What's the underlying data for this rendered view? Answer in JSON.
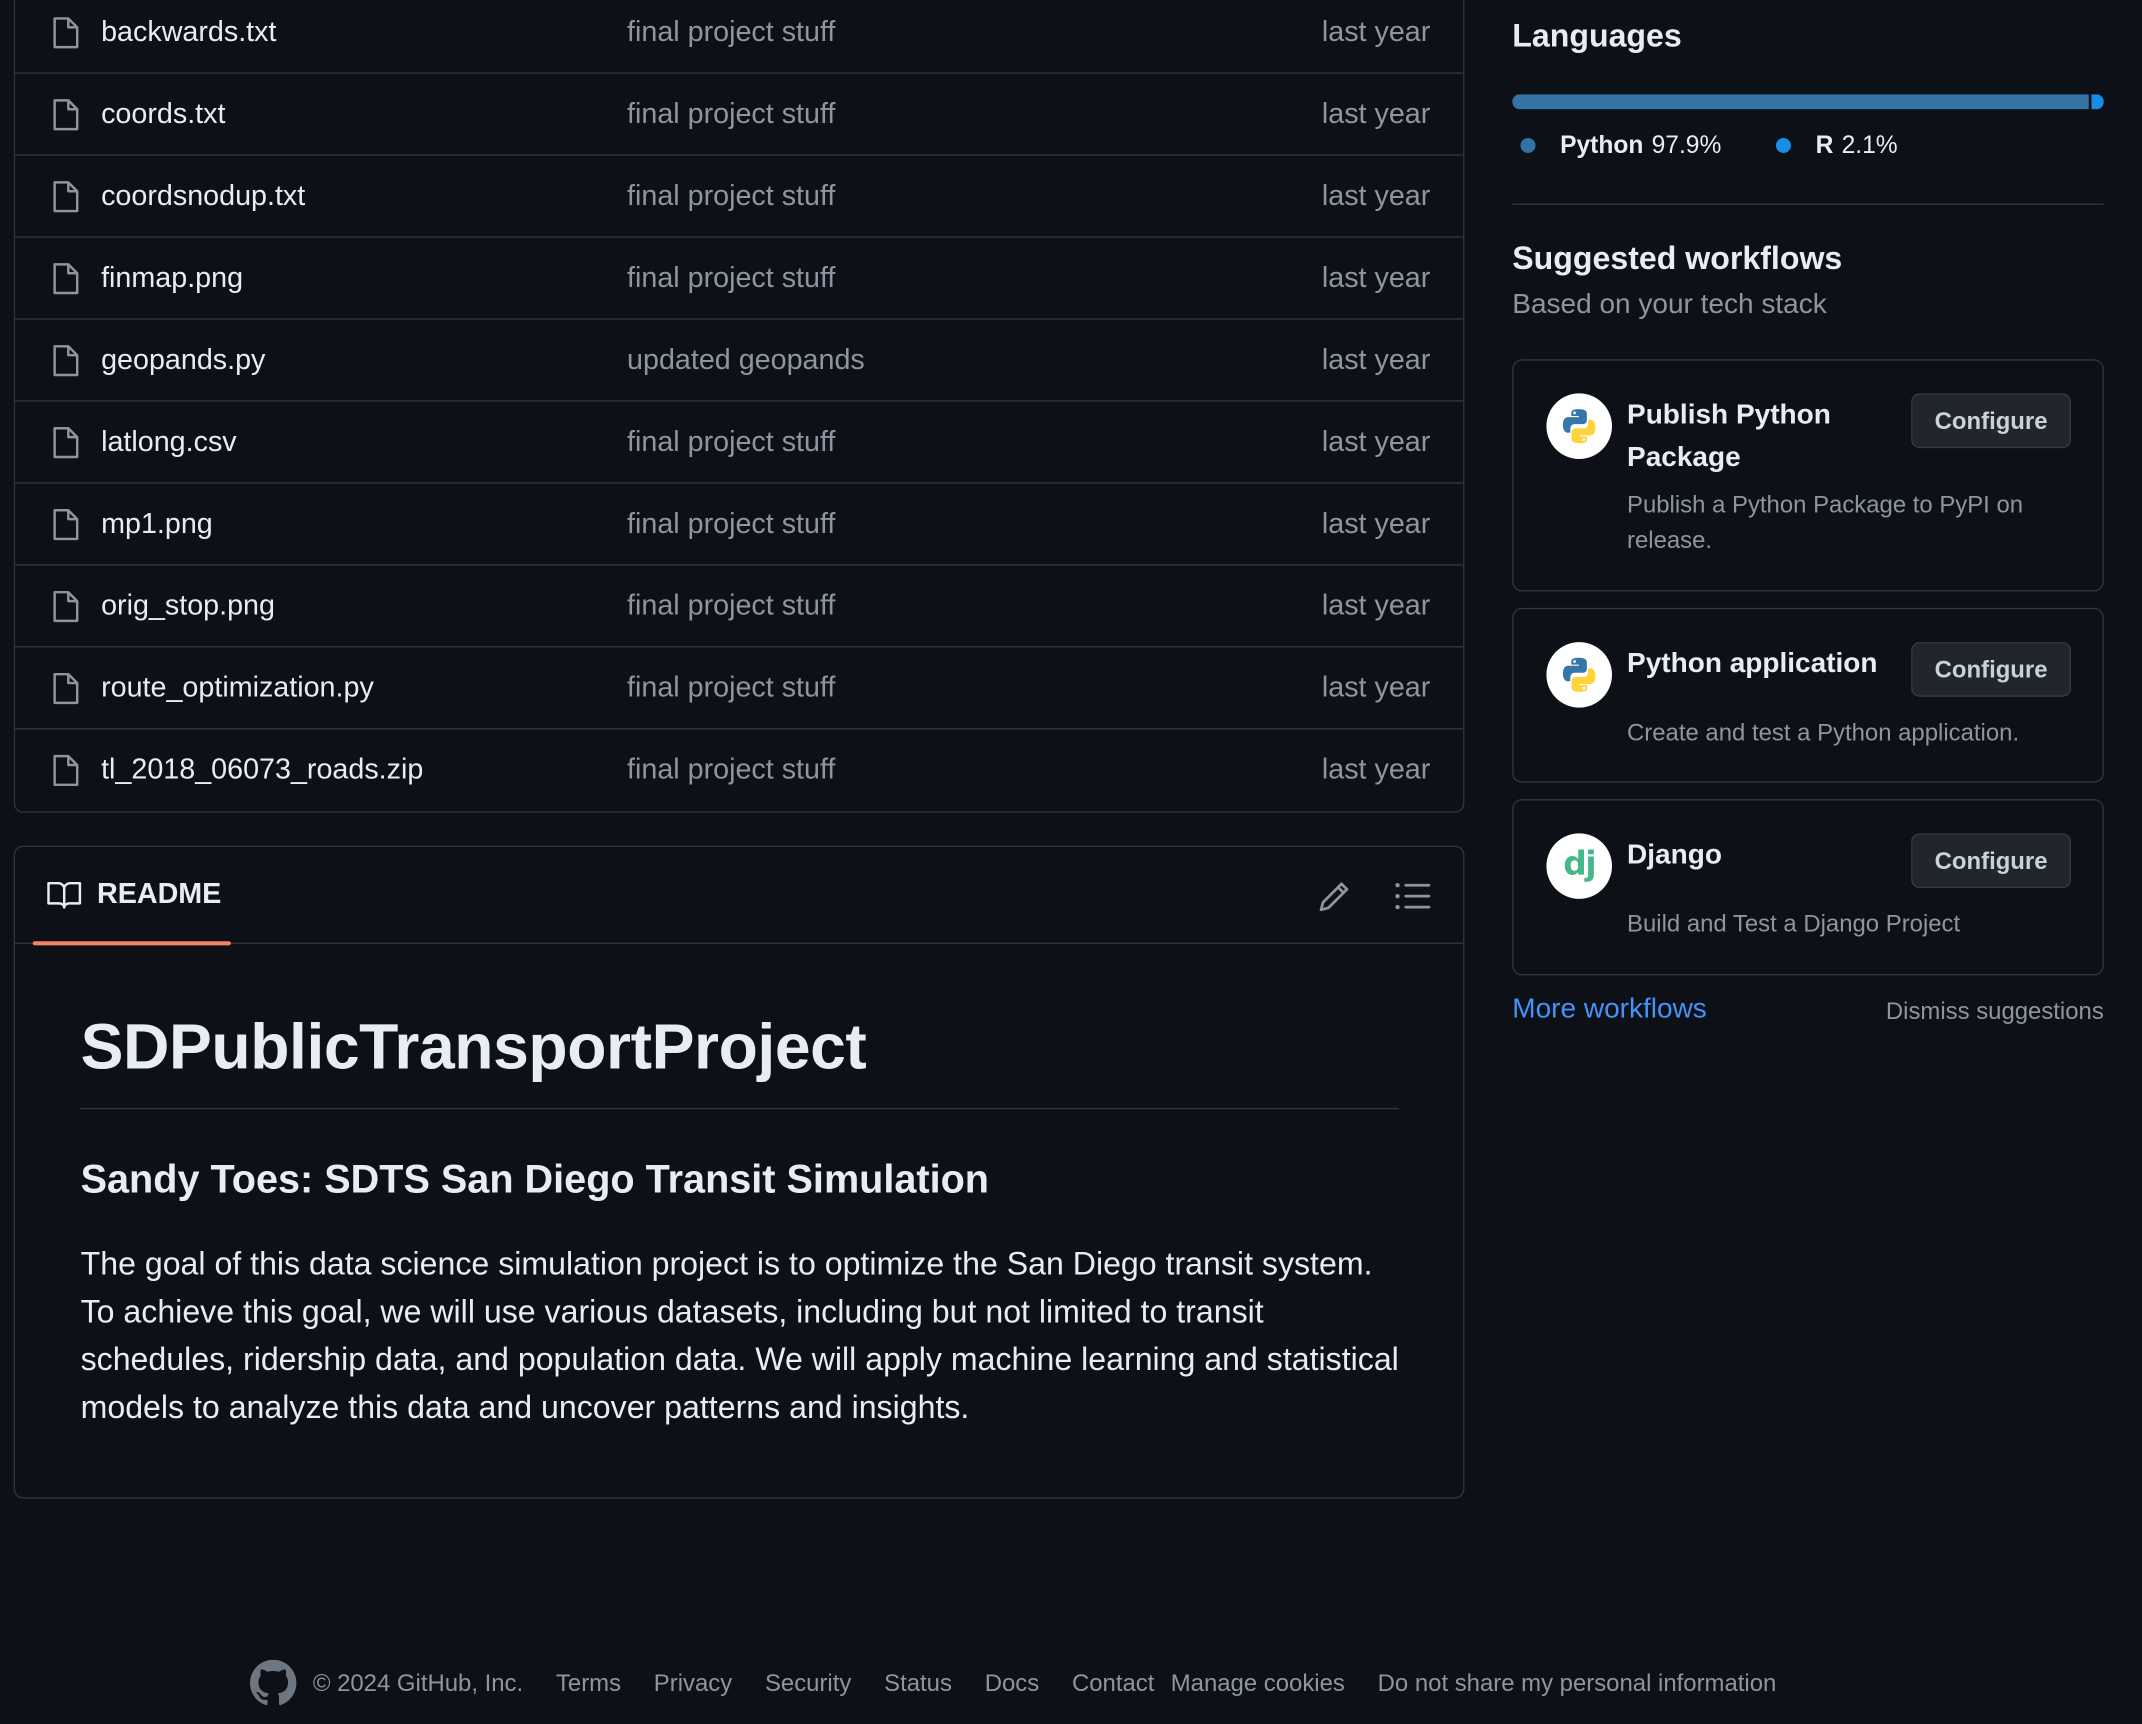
{
  "files": [
    {
      "name": "backwards.txt",
      "message": "final project stuff",
      "date": "last year"
    },
    {
      "name": "coords.txt",
      "message": "final project stuff",
      "date": "last year"
    },
    {
      "name": "coordsnodup.txt",
      "message": "final project stuff",
      "date": "last year"
    },
    {
      "name": "finmap.png",
      "message": "final project stuff",
      "date": "last year"
    },
    {
      "name": "geopands.py",
      "message": "updated geopands",
      "date": "last year"
    },
    {
      "name": "latlong.csv",
      "message": "final project stuff",
      "date": "last year"
    },
    {
      "name": "mp1.png",
      "message": "final project stuff",
      "date": "last year"
    },
    {
      "name": "orig_stop.png",
      "message": "final project stuff",
      "date": "last year"
    },
    {
      "name": "route_optimization.py",
      "message": "final project stuff",
      "date": "last year"
    },
    {
      "name": "tl_2018_06073_roads.zip",
      "message": "final project stuff",
      "date": "last year"
    }
  ],
  "readme": {
    "tab_label": "README",
    "h1": "SDPublicTransportProject",
    "h3": "Sandy Toes: SDTS San Diego Transit Simulation",
    "paragraph": "The goal of this data science simulation project is to optimize the San Diego transit system. To achieve this goal, we will use various datasets, including but not limited to transit schedules, ridership data, and population data. We will apply machine learning and statistical models to analyze this data and uncover patterns and insights."
  },
  "languages": {
    "title": "Languages",
    "items": [
      {
        "name": "Python",
        "percent": "97.9%",
        "share": 0.979,
        "color": "#3572A5"
      },
      {
        "name": "R",
        "percent": "2.1%",
        "share": 0.021,
        "color": "#198CE7"
      }
    ]
  },
  "workflows": {
    "title": "Suggested workflows",
    "subtitle": "Based on your tech stack",
    "configure_label": "Configure",
    "items": [
      {
        "name": "Publish Python Package",
        "description": "Publish a Python Package to PyPI on release.",
        "icon": "python-icon"
      },
      {
        "name": "Python application",
        "description": "Create and test a Python application.",
        "icon": "python-icon"
      },
      {
        "name": "Django",
        "description": "Build and Test a Django Project",
        "icon": "django-icon",
        "icon_text": "dj"
      }
    ],
    "more_label": "More workflows",
    "dismiss_label": "Dismiss suggestions"
  },
  "footer": {
    "copyright": "© 2024 GitHub, Inc.",
    "links": [
      "Terms",
      "Privacy",
      "Security",
      "Status",
      "Docs",
      "Contact",
      "Manage cookies",
      "Do not share my personal information"
    ]
  },
  "colors": {
    "background": "#0d1117",
    "border": "#30363d",
    "muted_text": "#8d96a0",
    "link": "#4493f8",
    "readme_tab_accent": "#f78166"
  }
}
